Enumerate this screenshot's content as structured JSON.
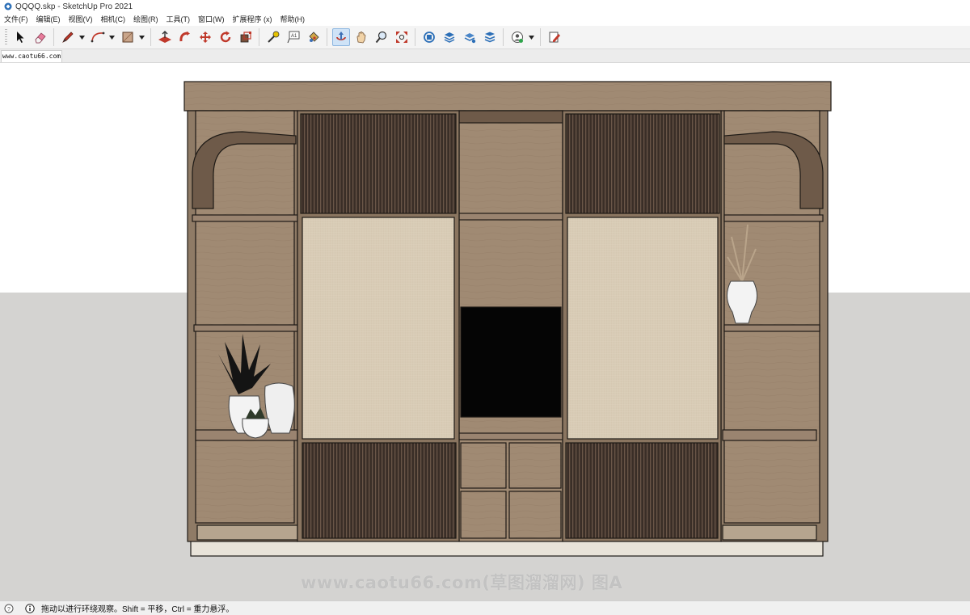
{
  "window": {
    "title": "QQQQ.skp - SketchUp Pro 2021"
  },
  "menu": {
    "items": [
      "文件(F)",
      "编辑(E)",
      "视图(V)",
      "相机(C)",
      "绘图(R)",
      "工具(T)",
      "窗口(W)",
      "扩展程序 (x)",
      "帮助(H)"
    ]
  },
  "toolbar": {
    "buttons": [
      "select-icon",
      "eraser-icon",
      "pencil-line-icon",
      "arc-icon",
      "rectangle-icon",
      "push-pull-icon",
      "follow-me-icon",
      "move-icon",
      "rotate-icon",
      "scale-icon",
      "tape-measure-icon",
      "text-icon",
      "paint-bucket-icon",
      "orbit-icon",
      "pan-icon",
      "zoom-icon",
      "zoom-extents-icon",
      "warehouse-icon",
      "extension-warehouse-icon",
      "layout-icon",
      "extension-manager-icon",
      "account-icon",
      "send-feedback-icon"
    ],
    "active": "orbit-icon"
  },
  "scene": {
    "tab_label": "www.caotu66.com"
  },
  "viewport": {
    "sky_color": "#ffffff",
    "ground_color": "#d4d3d1",
    "horizon_fraction": 0.43,
    "tv_screen_color": "#050505",
    "wood_color": "#a08a73",
    "fabric_color": "#d9ccb6",
    "slat_color": "#3a2e27"
  },
  "watermark": {
    "text": "www.caotu66.com(草图溜溜网) 图A"
  },
  "status": {
    "text": "拖动以进行环绕观察。Shift = 平移，Ctrl = 重力悬浮。"
  }
}
